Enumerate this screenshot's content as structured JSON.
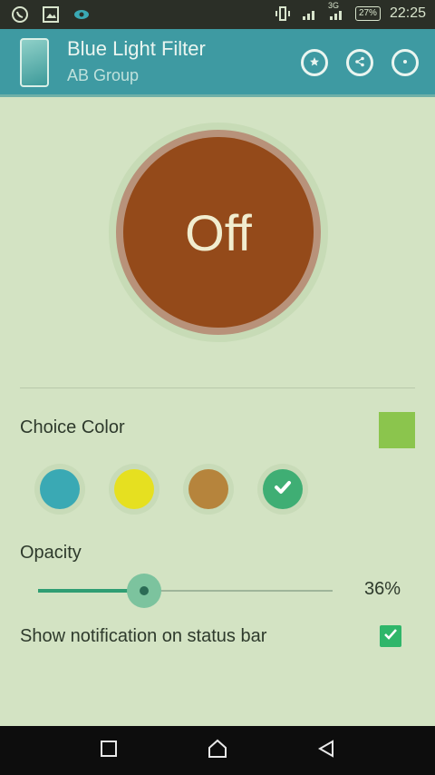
{
  "status_bar": {
    "time": "22:25",
    "battery": "27%",
    "network": "3G",
    "icons": [
      "whatsapp-icon",
      "gallery-icon",
      "eye-icon",
      "vibrate-icon",
      "signal-icon",
      "signal-3g-icon",
      "battery-icon"
    ]
  },
  "app_bar": {
    "title": "Blue Light Filter",
    "subtitle": "AB Group",
    "actions": [
      "star-icon",
      "share-icon",
      "more-icon"
    ],
    "color": "#3e9aa2"
  },
  "toggle": {
    "label": "Off",
    "color": "#944a1a"
  },
  "choice_color": {
    "label": "Choice Color",
    "selected_preview": "#8bc54d",
    "swatches": [
      {
        "color": "#3aa9b4",
        "selected": false
      },
      {
        "color": "#e6e020",
        "selected": false
      },
      {
        "color": "#b6843c",
        "selected": false
      },
      {
        "color": "#3fae74",
        "selected": true
      }
    ]
  },
  "opacity": {
    "label": "Opacity",
    "value_text": "36%",
    "value": 0.36
  },
  "notification": {
    "label": "Show notification on status bar",
    "checked": true
  },
  "nav_bar": {
    "buttons": [
      "recent-apps-icon",
      "home-icon",
      "back-icon"
    ]
  }
}
